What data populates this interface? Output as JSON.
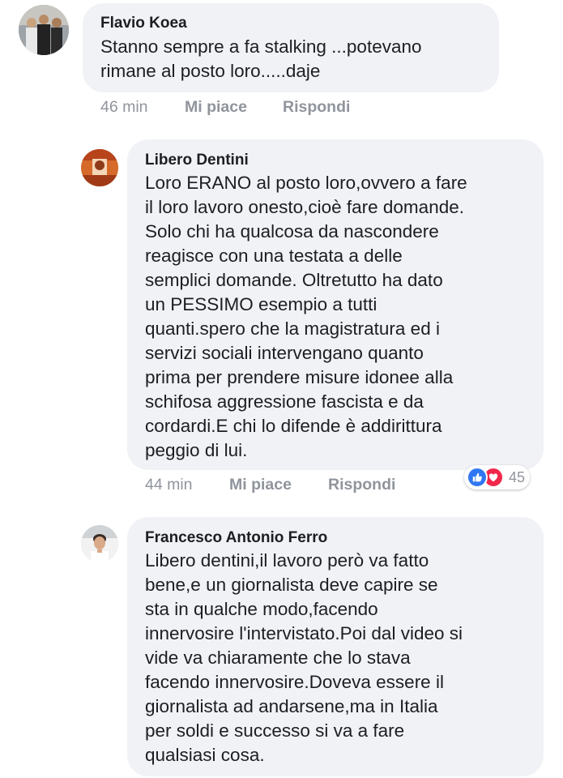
{
  "comments": [
    {
      "author": "Flavio Koea",
      "text": "Stanno sempre a fa stalking ...potevano\nrimane al posto loro.....daje",
      "time": "46 min",
      "like_label": "Mi piace",
      "reply_label": "Rispondi"
    },
    {
      "author": "Libero Dentini",
      "text": "Loro ERANO al posto loro,ovvero a fare\nil loro lavoro onesto,cioè fare domande.\nSolo chi ha qualcosa da nascondere\nreagisce con una testata a delle\nsemplici domande. Oltretutto ha dato\nun PESSIMO esempio a tutti\nquanti.spero che la magistratura ed i\nservizi sociali intervengano quanto\nprima per prendere misure idonee alla\nschifosa aggressione fascista e da\ncordardi.E chi lo difende è addirittura\npeggio di lui.",
      "time": "44 min",
      "like_label": "Mi piace",
      "reply_label": "Rispondi",
      "reactions": {
        "count": "45",
        "types": [
          "like-icon",
          "love-icon"
        ],
        "colors": {
          "like": "#2f77f2",
          "love": "#f0284a"
        }
      }
    },
    {
      "author": "Francesco Antonio Ferro",
      "text": "Libero dentini,il lavoro però va fatto\nbene,e un giornalista deve capire se\nsta in qualche modo,facendo\ninnervosire l'intervistato.Poi dal video si\nvide va chiaramente che lo stava\nfacendo innervosire.Doveva essere il\ngiornalista ad andarsene,ma in Italia\nper soldi e successo si va a fare\nqualsiasi cosa."
    }
  ],
  "colors": {
    "bubble": "#f1f2f6",
    "meta_text": "#90949c",
    "name_text": "#1c1e21"
  }
}
